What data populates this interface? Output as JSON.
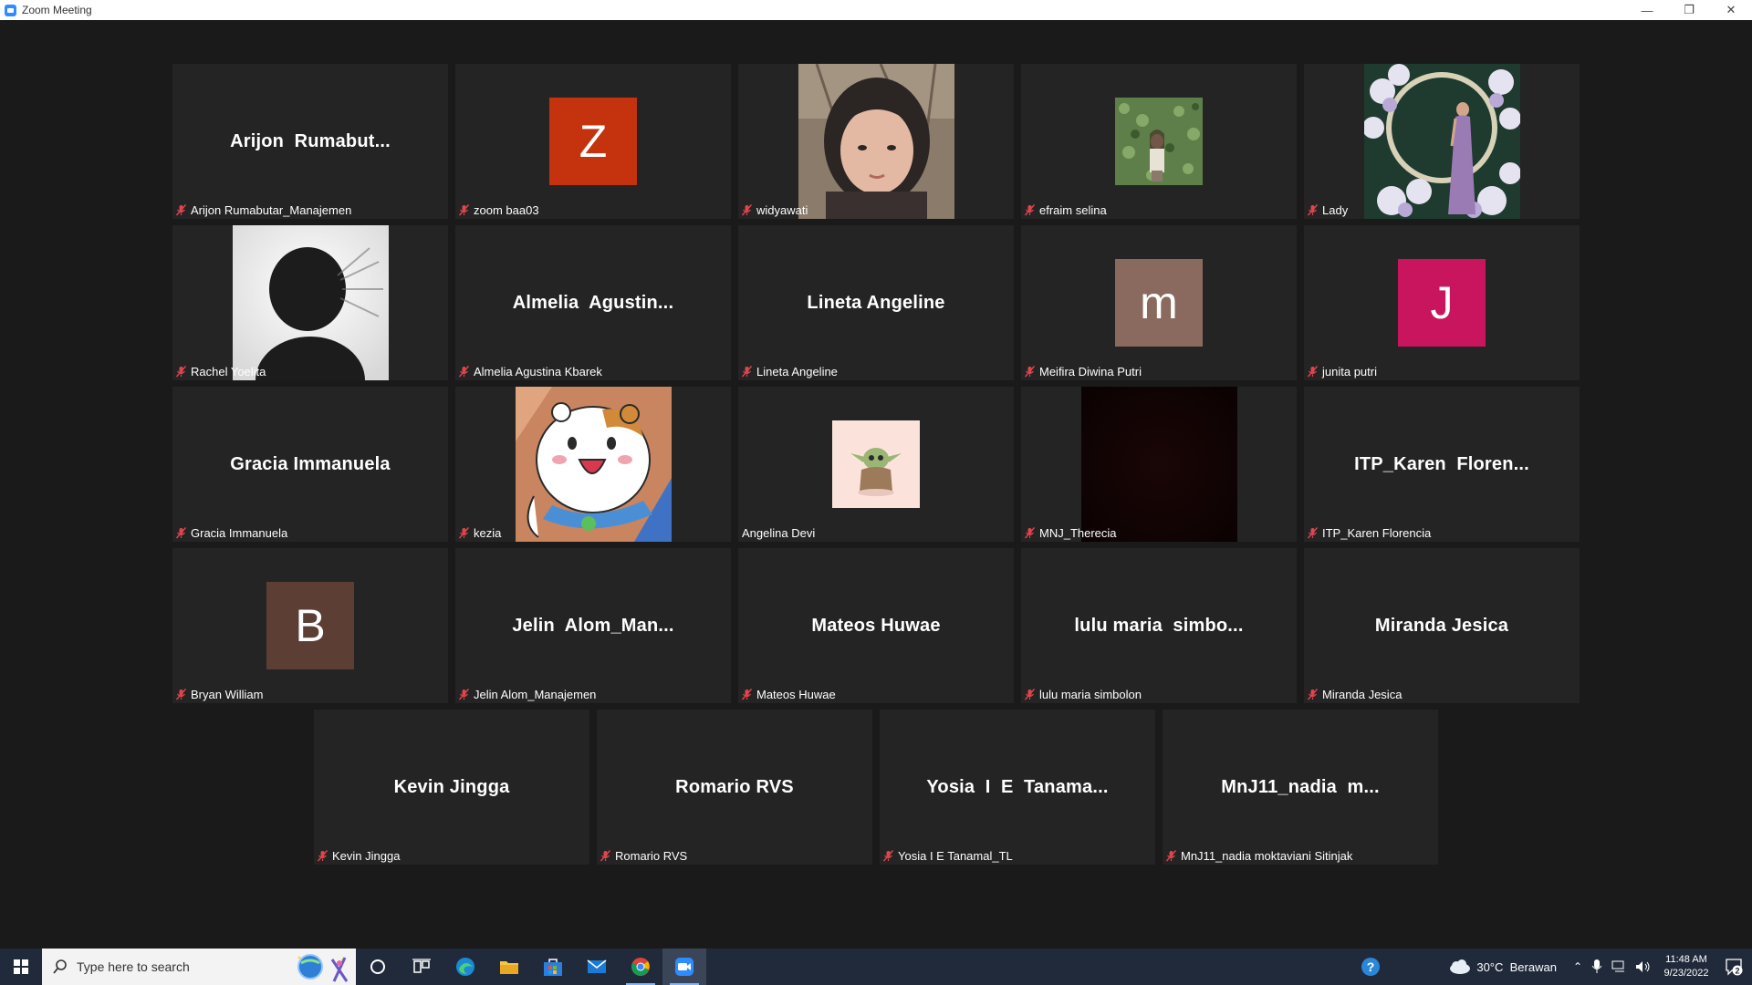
{
  "window": {
    "title": "Zoom Meeting"
  },
  "controls": {
    "minimize": "—",
    "restore": "❐",
    "close": "✕"
  },
  "tiles": [
    {
      "type": "name",
      "big": "Arijon  Rumabut...",
      "label": "Arijon Rumabutar_Manajemen",
      "muted": true
    },
    {
      "type": "letter",
      "letter": "Z",
      "color": "#c4330e",
      "label": "zoom baa03",
      "muted": true
    },
    {
      "type": "photo",
      "photo": "portrait",
      "label": "widyawati",
      "muted": true
    },
    {
      "type": "photo",
      "photo": "greenwall",
      "label": "efraim selina",
      "muted": true
    },
    {
      "type": "photo",
      "photo": "flowers",
      "label": "Lady",
      "muted": true
    },
    {
      "type": "photo",
      "photo": "silhouette",
      "label": "Rachel Yoelita",
      "muted": true
    },
    {
      "type": "name",
      "big": "Almelia  Agustin...",
      "label": "Almelia Agustina Kbarek",
      "muted": true
    },
    {
      "type": "name",
      "big": "Lineta Angeline",
      "label": "Lineta Angeline",
      "muted": true
    },
    {
      "type": "letter",
      "letter": "m",
      "color": "#8a6a5e",
      "label": "Meifira Diwina Putri",
      "muted": true
    },
    {
      "type": "letter",
      "letter": "J",
      "color": "#c8155e",
      "label": "junita putri",
      "muted": true
    },
    {
      "type": "name",
      "big": "Gracia Immanuela",
      "label": "Gracia Immanuela",
      "muted": true
    },
    {
      "type": "photo",
      "photo": "hamster",
      "label": "kezia",
      "muted": true
    },
    {
      "type": "photo",
      "photo": "yoda",
      "label": "Angelina Devi",
      "muted": false
    },
    {
      "type": "photo",
      "photo": "dark",
      "label": "MNJ_Therecia",
      "muted": true
    },
    {
      "type": "name",
      "big": "ITP_Karen  Floren...",
      "label": "ITP_Karen Florencia",
      "muted": true
    },
    {
      "type": "letter",
      "letter": "B",
      "color": "#5c3e35",
      "label": "Bryan William",
      "muted": true
    },
    {
      "type": "name",
      "big": "Jelin  Alom_Man...",
      "label": "Jelin Alom_Manajemen",
      "muted": true
    },
    {
      "type": "name",
      "big": "Mateos Huwae",
      "label": "Mateos Huwae",
      "muted": true
    },
    {
      "type": "name",
      "big": "lulu maria  simbo...",
      "label": "lulu maria simbolon",
      "muted": true
    },
    {
      "type": "name",
      "big": "Miranda Jesica",
      "label": "Miranda Jesica",
      "muted": true
    },
    {
      "type": "name",
      "big": "Kevin Jingga",
      "label": "Kevin Jingga",
      "muted": true
    },
    {
      "type": "name",
      "big": "Romario RVS",
      "label": "Romario RVS",
      "muted": true
    },
    {
      "type": "name",
      "big": "Yosia  I  E  Tanama...",
      "label": "Yosia I E Tanamal_TL",
      "muted": true
    },
    {
      "type": "name",
      "big": "MnJ11_nadia  m...",
      "label": "MnJ11_nadia moktaviani Sitinjak",
      "muted": true
    }
  ],
  "taskbar": {
    "search_placeholder": "Type here to search",
    "weather": "30°C  Berawan",
    "time": "11:48 AM",
    "date": "9/23/2022",
    "notifications": "2"
  },
  "colors": {
    "muted_mic": "#e0454f",
    "background": "#1a1a1a",
    "tile": "#242424"
  }
}
